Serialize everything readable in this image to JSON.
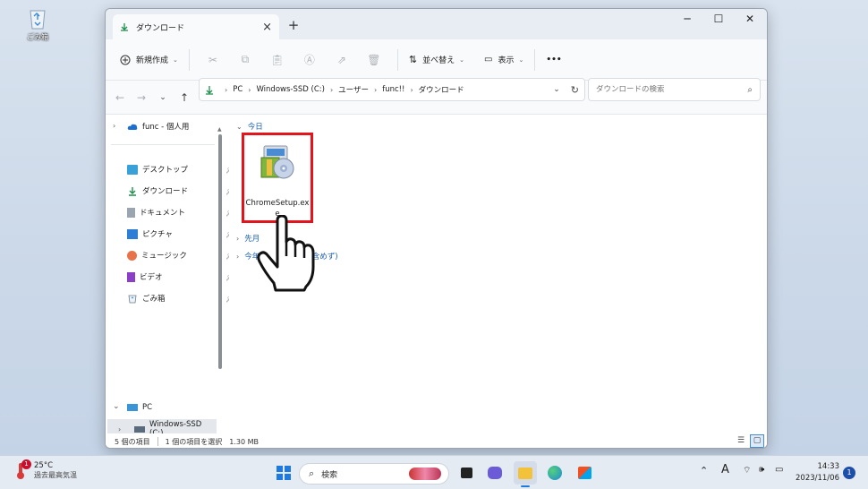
{
  "desktop": {
    "recycle_bin_label": "ごみ箱"
  },
  "window": {
    "tab_title": "ダウンロード",
    "toolbar": {
      "new_label": "新規作成",
      "sort_label": "並べ替え",
      "view_label": "表示",
      "more_label": "•••"
    },
    "breadcrumb": [
      "PC",
      "Windows-SSD (C:)",
      "ユーザー",
      "func!!",
      "ダウンロード"
    ],
    "search_placeholder": "ダウンロードの検索",
    "sidebar": {
      "onedrive": "func - 個人用",
      "quick": [
        {
          "label": "デスクトップ",
          "icon": "desktop-folder-icon"
        },
        {
          "label": "ダウンロード",
          "icon": "download-folder-icon"
        },
        {
          "label": "ドキュメント",
          "icon": "documents-folder-icon"
        },
        {
          "label": "ピクチャ",
          "icon": "pictures-folder-icon"
        },
        {
          "label": "ミュージック",
          "icon": "music-folder-icon"
        },
        {
          "label": "ビデオ",
          "icon": "videos-folder-icon"
        },
        {
          "label": "ごみ箱",
          "icon": "recycle-bin-icon"
        }
      ],
      "pc": "PC",
      "drive": "Windows-SSD (C:)"
    },
    "groups": {
      "today": "今日",
      "last_month": "先月",
      "earlier_this_year": "今年に入って (先月を含めず)",
      "earlier_this_year_visible": "今年に",
      "earlier_this_year_tail": "含めず)"
    },
    "file": {
      "name": "ChromeSetup.exe",
      "name_line1": "ChromeSetup.ex",
      "name_line2": "e"
    },
    "status": {
      "count": "5 個の項目",
      "selected": "1 個の項目を選択",
      "size": "1.30 MB"
    }
  },
  "taskbar": {
    "weather_temp": "25°C",
    "weather_desc": "過去最高気温",
    "weather_badge": "1",
    "search_label": "検索",
    "ime_label": "A",
    "time": "14:33",
    "date": "2023/11/06",
    "notification_count": "1"
  },
  "colors": {
    "highlight": "#e3141b",
    "accent": "#1a5fb4"
  }
}
